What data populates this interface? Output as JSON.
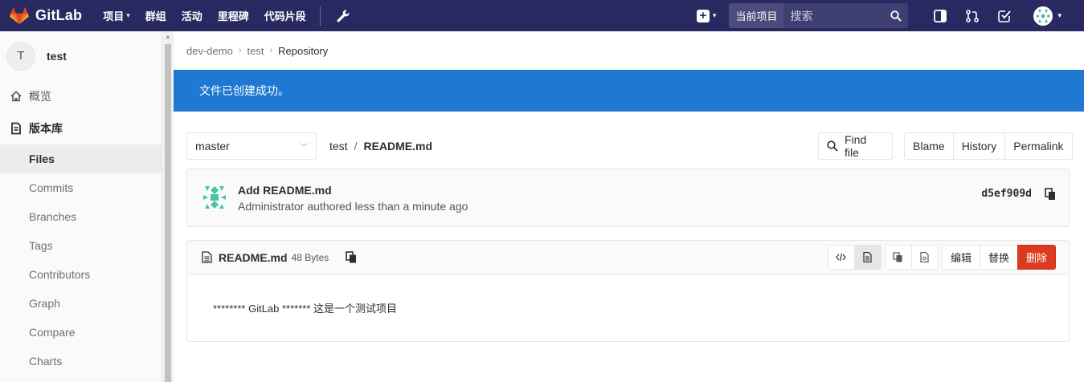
{
  "navbar": {
    "logo_text": "GitLab",
    "links": [
      "项目",
      "群组",
      "活动",
      "里程碑",
      "代码片段"
    ],
    "search_scope": "当前项目",
    "search_placeholder": "搜索"
  },
  "sidebar": {
    "project_initial": "T",
    "project_name": "test",
    "overview": "概览",
    "repository": "版本库",
    "sub_items": [
      "Files",
      "Commits",
      "Branches",
      "Tags",
      "Contributors",
      "Graph",
      "Compare",
      "Charts"
    ]
  },
  "breadcrumb": [
    "dev-demo",
    "test",
    "Repository"
  ],
  "flash": "文件已创建成功。",
  "tree": {
    "branch": "master",
    "path_dir": "test",
    "path_sep": "/",
    "path_file": "README.md",
    "find_file": "Find file",
    "blame": "Blame",
    "history": "History",
    "permalink": "Permalink"
  },
  "commit": {
    "title": "Add README.md",
    "meta": "Administrator authored less than a minute ago",
    "sha": "d5ef909d"
  },
  "file": {
    "name": "README.md",
    "size": "48 Bytes",
    "edit": "编辑",
    "replace": "替换",
    "delete": "删除",
    "content": "******** GitLab ******* 这是一个测试项目"
  },
  "colors": {
    "navbar": "#292961",
    "flash": "#1f78d1",
    "danger": "#db3b21",
    "logo": "#e24329"
  }
}
